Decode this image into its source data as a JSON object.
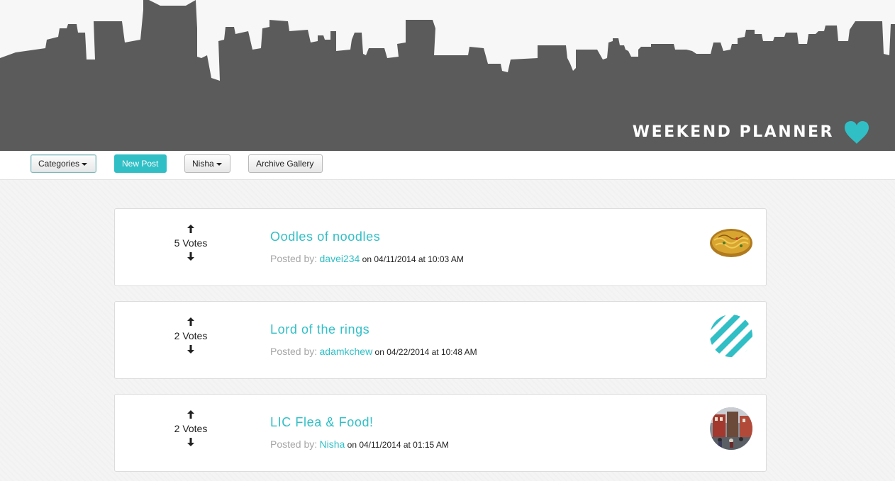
{
  "header": {
    "brand": "WEEKEND PLANNER",
    "brand_color": "#ffffff",
    "skyline_color": "#5b5b5b",
    "heart_color": "#31bfc6"
  },
  "toolbar": {
    "categories_label": "Categories",
    "new_post_label": "New Post",
    "user_label": "Nisha",
    "archive_label": "Archive Gallery"
  },
  "posts": [
    {
      "title": "Oodles of noodles",
      "votes": "5 Votes",
      "posted_by": "Posted by:",
      "user": "davei234",
      "when": "on 04/11/2014 at 10:03 AM",
      "avatar": "noodles-photo"
    },
    {
      "title": "Lord of the rings",
      "votes": "2 Votes",
      "posted_by": "Posted by:",
      "user": "adamkchew",
      "when": "on 04/22/2014 at 10:48 AM",
      "avatar": "teal-stripes-pattern"
    },
    {
      "title": "LIC Flea & Food!",
      "votes": "2 Votes",
      "posted_by": "Posted by:",
      "user": "Nisha",
      "when": "on 04/11/2014 at 01:15 AM",
      "avatar": "street-market-photo"
    }
  ],
  "accent_color": "#31bfc6"
}
